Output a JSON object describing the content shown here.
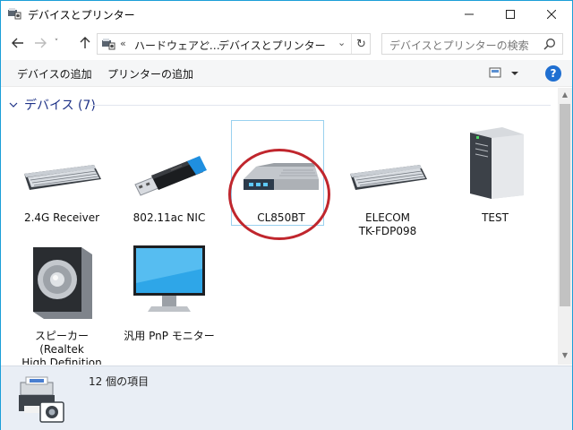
{
  "window": {
    "title": "デバイスとプリンター",
    "accent_color": "#1b9ed8"
  },
  "nav": {
    "recent_glyph": "˅",
    "breadcrumb_prefix": "«",
    "breadcrumbs": [
      "ハードウェアと…",
      "デバイスとプリンター"
    ],
    "search_placeholder": "デバイスとプリンターの検索"
  },
  "commands": {
    "add_device": "デバイスの追加",
    "add_printer": "プリンターの追加"
  },
  "group": {
    "title": "デバイス (7)"
  },
  "devices": [
    {
      "label": "2.4G Receiver",
      "icon": "keyboard-icon"
    },
    {
      "label": "802.11ac NIC",
      "icon": "usb-dongle-icon"
    },
    {
      "label": "CL850BT",
      "icon": "router-device-icon",
      "selected": true,
      "annotated": true
    },
    {
      "label": "ELECOM\nTK-FDP098",
      "icon": "keyboard-icon"
    },
    {
      "label": "TEST",
      "icon": "computer-tower-icon"
    },
    {
      "label": "スピーカー (Realtek\nHigh Definition\nAudio)",
      "icon": "speaker-icon"
    },
    {
      "label": "汎用 PnP モニター",
      "icon": "monitor-icon"
    }
  ],
  "details": {
    "count_text": "12 個の項目",
    "icon": "devices-printers-icon"
  },
  "annotation_color": "#c0262d"
}
